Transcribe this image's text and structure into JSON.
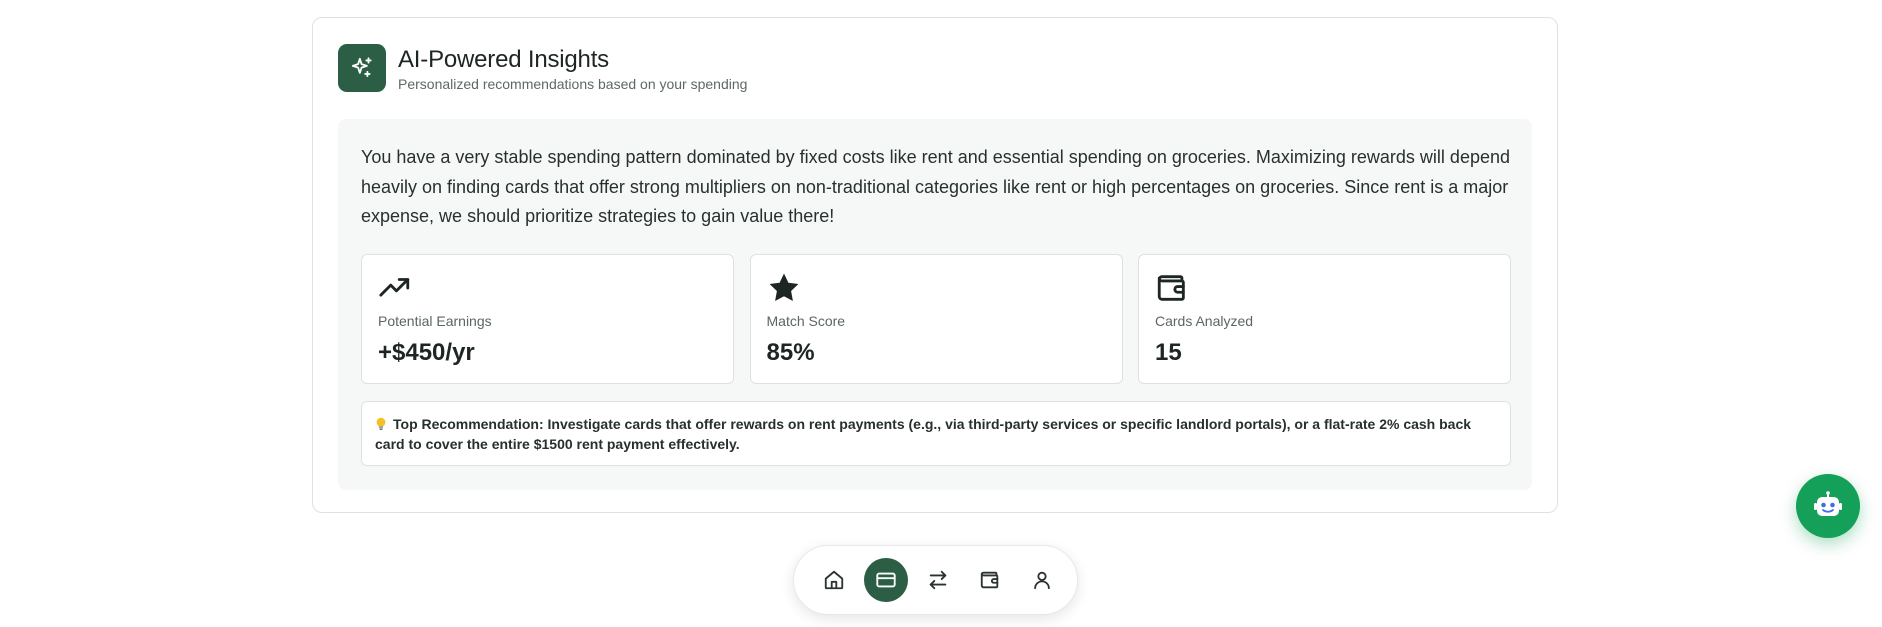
{
  "insights": {
    "title": "AI-Powered Insights",
    "subtitle": "Personalized recommendations based on your spending",
    "header_icon": "sparkles-icon",
    "summary": "You have a very stable spending pattern dominated by fixed costs like rent and essential spending on groceries. Maximizing rewards will depend heavily on finding cards that offer strong multipliers on non-traditional categories like rent or high percentages on groceries. Since rent is a major expense, we should prioritize strategies to gain value there!",
    "stats": [
      {
        "icon": "trending-up-icon",
        "label": "Potential Earnings",
        "value": "+$450/yr"
      },
      {
        "icon": "star-icon",
        "label": "Match Score",
        "value": "85%"
      },
      {
        "icon": "wallet-icon",
        "label": "Cards Analyzed",
        "value": "15"
      }
    ],
    "recommendation": {
      "icon": "lightbulb-icon",
      "text": "Top Recommendation: Investigate cards that offer rewards on rent payments (e.g., via third-party services or specific landlord portals), or a flat-rate 2% cash back card to cover the entire $1500 rent payment effectively."
    }
  },
  "bottom_nav": {
    "items": [
      {
        "icon": "home-icon",
        "active": false
      },
      {
        "icon": "credit-card-icon",
        "active": true
      },
      {
        "icon": "transfer-icon",
        "active": false
      },
      {
        "icon": "wallet-icon",
        "active": false
      },
      {
        "icon": "user-icon",
        "active": false
      }
    ]
  },
  "chat_fab": {
    "icon": "robot-icon"
  },
  "colors": {
    "brand": "#2c5e45",
    "fab": "#15a05a",
    "panel_bg": "#f6f8f7"
  }
}
